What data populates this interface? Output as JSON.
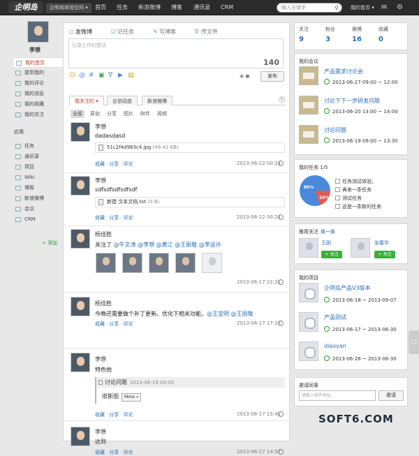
{
  "topbar": {
    "logo": "企明岛",
    "space": "企明岛体验空间 ▾",
    "nav": [
      "首页",
      "任务",
      "新浪微博",
      "博客",
      "通讯录",
      "CRM"
    ],
    "search_placeholder": "输入关键字",
    "home_label": "我的首页 ▾"
  },
  "sidebar": {
    "user": "李想",
    "items": [
      "我的首页",
      "提到我的",
      "我的评论",
      "我的消息",
      "我的收藏",
      "我的关注"
    ],
    "apps_title": "应用",
    "apps": [
      "任务",
      "通讯录",
      "项目",
      "Wiki",
      "博客",
      "新浪微博",
      "会议",
      "CRM"
    ],
    "add": "添加"
  },
  "composer": {
    "tabs": [
      "发微博",
      "记任务",
      "写博客",
      "传文件"
    ],
    "placeholder": "记录工作的想法",
    "counter": "140",
    "post": "发布"
  },
  "feed_tabs": [
    "我关注的 ▾",
    "企划动态",
    "新浪微博"
  ],
  "sub_tabs": [
    "全部",
    "原创",
    "分享",
    "图片",
    "附件",
    "视频"
  ],
  "posts": [
    {
      "name": "李想",
      "text": "dadasdasd",
      "file": "51c2f4d983c4.jpg",
      "size": "(49.41 KB)",
      "time": "2013-06-22 00:24"
    },
    {
      "name": "李想",
      "text": "sdfsdfsdfsdfsdf",
      "file": "新建 文本文档.txt",
      "size": "(0 B)",
      "time": "2013-06-22 00:24"
    },
    {
      "name": "杨佳胜",
      "prefix": "关注了",
      "mentions": [
        "@牛文涛",
        "@李想",
        "@黄江",
        "@王丽敬",
        "@李运许"
      ],
      "time": "2013-06-17 22:21"
    },
    {
      "name": "杨佳胜",
      "text": "今晚还需要做个补丁更新。优化下相关功能。",
      "mentions": [
        "@王宝明",
        "@王丽敬"
      ],
      "time": "2013-06-17 17:18"
    },
    {
      "name": "李想",
      "text": "特色他",
      "quote_title": "讨论问题",
      "quote_time": "2013-06-19 09:00",
      "quote_body": "很斯图",
      "more": "More »",
      "time": "2013-06-17 15:41"
    },
    {
      "name": "李想",
      "text": "达到",
      "time": "2013-06-17 14:57"
    }
  ],
  "actions": {
    "collect": "收藏",
    "share": "分享",
    "comment": "评论",
    "sep": "·"
  },
  "stats": [
    {
      "label": "关注",
      "value": "9"
    },
    {
      "label": "粉丝",
      "value": "3"
    },
    {
      "label": "微博",
      "value": "16"
    },
    {
      "label": "收藏",
      "value": "0"
    }
  ],
  "meetings": {
    "title": "我的会议",
    "items": [
      {
        "title": "产品需求讨论会",
        "time": "2013-06-27 09:00 ~ 12:00"
      },
      {
        "title": "讨论下下一步研发问题",
        "time": "2013-06-20 13:00 ~ 14:00"
      },
      {
        "title": "讨论问题",
        "time": "2013-06-19 09:00 ~ 13:30"
      }
    ]
  },
  "tasks": {
    "title": "我的任务",
    "count": "1/5",
    "pie_labels": [
      "80%",
      "20%"
    ],
    "items": [
      "任务测试体验。",
      "再来一条任务",
      "测试任务",
      "这是一条新的任务"
    ]
  },
  "chart_data": {
    "type": "pie",
    "categories": [
      "80%",
      "20%"
    ],
    "values": [
      80,
      20
    ],
    "colors": [
      "#4a89dc",
      "#e25b4f"
    ]
  },
  "recommend": {
    "title": "推荐关注",
    "refresh": "换一换",
    "users": [
      {
        "name": "王刚",
        "btn": "+ 关注"
      },
      {
        "name": "张春华",
        "btn": "+ 关注"
      }
    ]
  },
  "projects": {
    "title": "我的项目",
    "items": [
      {
        "title": "企明岛产品V3版本",
        "time": "2013-06-18 ~ 2013-09-07"
      },
      {
        "title": "产品测试",
        "time": "2013-06-17 ~ 2013-06-30"
      },
      {
        "title": "diaoyan",
        "time": "2013-06-26 ~ 2013-06-30"
      }
    ]
  },
  "invite": {
    "title": "邀请同事",
    "placeholder": "请输入邮件地址...",
    "button": "邀请"
  },
  "watermark": "SOFT6.COM"
}
